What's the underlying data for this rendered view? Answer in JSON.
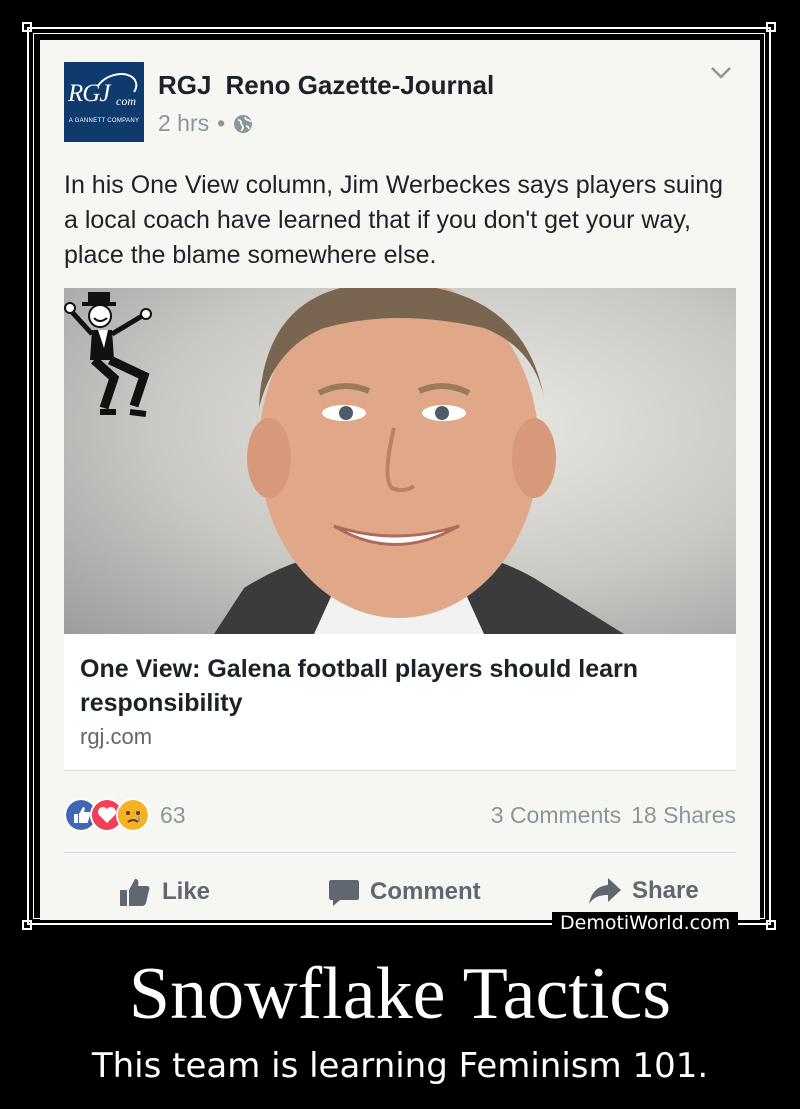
{
  "post": {
    "logo_text": "RGJ",
    "logo_com": "com",
    "logo_subtext": "A GANNETT COMPANY",
    "page_short": "RGJ",
    "page_name": "Reno Gazette-Journal",
    "time": "2 hrs",
    "separator": "•",
    "body": "In his One View column, Jim Werbeckes says players suing a local coach have learned that if you don't get your way, place the blame somewhere else.",
    "link_title": "One View: Galena football players should learn responsibility",
    "link_domain": "rgj.com",
    "reaction_count": "63",
    "comments": "3 Comments",
    "shares": "18 Shares",
    "actions": {
      "like": "Like",
      "comment": "Comment",
      "share": "Share"
    },
    "icons": [
      "globe-icon",
      "chevron-down-icon",
      "like-reaction-icon",
      "love-reaction-icon",
      "sad-reaction-icon",
      "thumbs-up-icon",
      "comment-icon",
      "share-arrow-icon"
    ]
  },
  "colors": {
    "facebook_blue": "#4267b2",
    "love_red": "#f33e58",
    "sad_yellow": "#f7b125",
    "logo_navy": "#0f3a6d"
  },
  "poster": {
    "watermark": "DemotiWorld.com",
    "title": "Snowflake Tactics",
    "caption": "This team is learning Feminism 101."
  }
}
